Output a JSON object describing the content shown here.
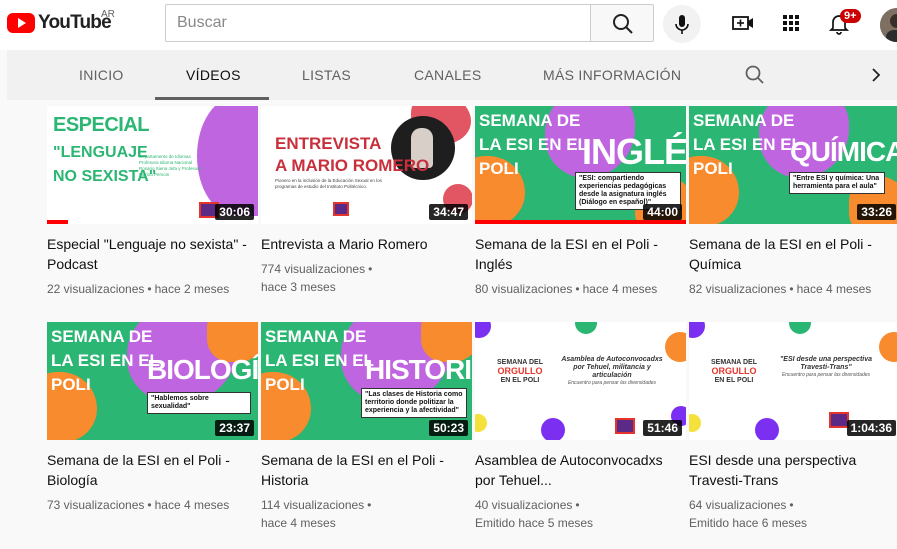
{
  "masthead": {
    "logo_text": "YouTube",
    "country": "AR",
    "search_placeholder": "Buscar",
    "notification_count": "9+"
  },
  "tabs": [
    {
      "label": "INICIO",
      "active": false
    },
    {
      "label": "VÍDEOS",
      "active": true
    },
    {
      "label": "LISTAS",
      "active": false
    },
    {
      "label": "CANALES",
      "active": false
    },
    {
      "label": "MÁS INFORMACIÓN",
      "active": false
    }
  ],
  "videos": [
    {
      "title": "Especial \"Lenguaje no sexista\" - Podcast",
      "meta1": "22 visualizaciones",
      "meta2": "hace 2 meses",
      "duration": "30:06",
      "watched_fraction": 0.1,
      "thumb": {
        "line1": "ESPECIAL",
        "line2": "\"LENGUAJE",
        "line3": "NO SEXISTA\"",
        "side": "Departamento de Idiomas Profesora Idioma Nacional Rosario Siena Jefa y Profesora Marina Persoin"
      }
    },
    {
      "title": "Entrevista a Mario Romero",
      "meta1": "774 visualizaciones",
      "meta2": "hace 3 meses",
      "duration": "34:47",
      "watched_fraction": 0,
      "thumb": {
        "line1": "ENTREVISTA",
        "line2": "A MARIO ROMERO",
        "side": "Pionero en la inclusión de la Educación Sexual en los programas de estudio del Instituto Politécnico."
      }
    },
    {
      "title": "Semana de la ESI en el Poli - Inglés",
      "meta1": "80 visualizaciones",
      "meta2": "hace 4 meses",
      "duration": "44:00",
      "watched_fraction": 1.0,
      "thumb": {
        "l1": "SEMANA DE",
        "l2": "LA ESI EN EL",
        "l3": "POLI",
        "big": "INGLÉS",
        "quote": "\"ESI: compartiendo experiencias pedagógicas desde la asignatura inglés (Diálogo en español)\""
      }
    },
    {
      "title": "Semana de la ESI en el Poli - Química",
      "meta1": "82 visualizaciones",
      "meta2": "hace 4 meses",
      "duration": "33:26",
      "watched_fraction": 0,
      "thumb": {
        "l1": "SEMANA DE",
        "l2": "LA ESI EN EL",
        "l3": "POLI",
        "big": "QUÍMICA",
        "quote": "\"Entre ESI y química: Una herramienta para el aula\""
      }
    },
    {
      "title": "Semana de la ESI en el Poli - Biología",
      "meta1": "73 visualizaciones",
      "meta2": "hace 4 meses",
      "duration": "23:37",
      "watched_fraction": 0,
      "thumb": {
        "l1": "SEMANA DE",
        "l2": "LA ESI EN EL",
        "l3": "POLI",
        "big": "BIOLOGÍA",
        "quote": "\"Hablemos sobre sexualidad\""
      }
    },
    {
      "title": "Semana de la ESI en el Poli - Historia",
      "meta1": "114 visualizaciones",
      "meta2": "hace 4 meses",
      "duration": "50:23",
      "watched_fraction": 0,
      "thumb": {
        "l1": "SEMANA DE",
        "l2": "LA ESI EN EL",
        "l3": "POLI",
        "big": "HISTORIA",
        "quote": "\"Las clases de Historia como territorio donde politizar la experiencia y la afectividad\""
      }
    },
    {
      "title": "Asamblea de Autoconvocadxs por Tehuel...",
      "meta1": "40 visualizaciones",
      "meta2": "Emitido hace 5 meses",
      "duration": "51:46",
      "watched_fraction": 0,
      "thumb": {
        "a": "SEMANA DEL",
        "b": "ORGULLO",
        "c": "EN EL POLI",
        "body_strong": "Asamblea de Autoconvocadxs por Tehuel, militancia y articulación",
        "body": "Encuentro para pensar las diversidades"
      }
    },
    {
      "title": "ESI desde una perspectiva Travesti-Trans",
      "meta1": "64 visualizaciones",
      "meta2": "Emitido hace 6 meses",
      "duration": "1:04:36",
      "watched_fraction": 0,
      "thumb": {
        "a": "SEMANA DEL",
        "b": "ORGULLO",
        "c": "EN EL POLI",
        "body_strong": "\"ESI desde una perspectiva Travesti-Trans\"",
        "body": "Encuentro para pensar las diversidades"
      }
    }
  ],
  "colors": {
    "brand_red": "#ff0000",
    "esi_green": "#2bb673",
    "esi_orange": "#f78b2e",
    "esi_purple": "#c065e0"
  }
}
